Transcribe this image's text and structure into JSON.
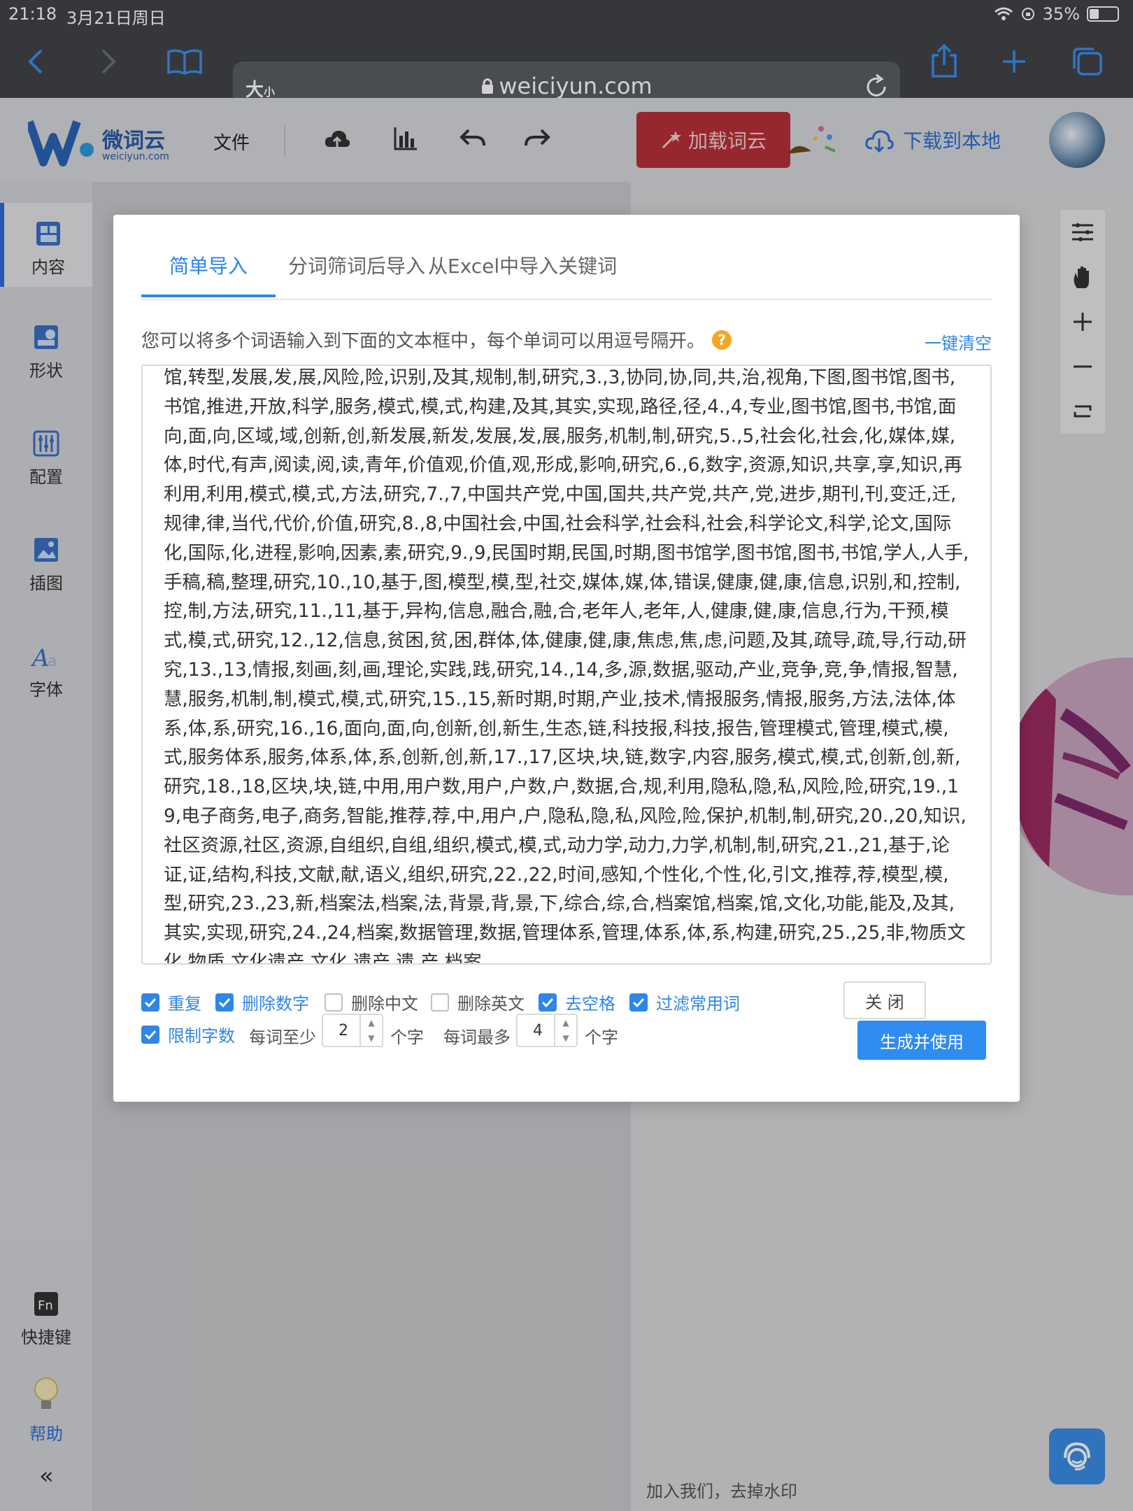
{
  "status": {
    "time": "21:18",
    "date": "3月21日周日",
    "battery": "35%",
    "battery_level": 0.35
  },
  "browser": {
    "aa": "大",
    "aa_small": "小",
    "domain": "weiciyun.com"
  },
  "app": {
    "brand": "微词云",
    "brand_sub": "weiciyun.com",
    "file_menu": "文件",
    "load_cloud": "加载词云",
    "download": "下载到本地"
  },
  "sidebar": {
    "items": [
      {
        "label": "内容"
      },
      {
        "label": "形状"
      },
      {
        "label": "配置"
      },
      {
        "label": "插图"
      },
      {
        "label": "字体"
      }
    ],
    "shortcut": "快捷键",
    "help": "帮助"
  },
  "canvas": {
    "watermark": "加入我们，去掉水印"
  },
  "modal": {
    "tabs": [
      {
        "label": "简单导入"
      },
      {
        "label": "分词筛词后导入"
      },
      {
        "label": "从Excel中导入关键词"
      }
    ],
    "hint": "您可以将多个词语输入到下面的文本框中，每个单词可以用逗号隔开。",
    "clear_all": "一键清空",
    "text": "馆,转型,发展,发,展,风险,险,识别,及其,规制,制,研究,3.,3,协同,协,同,共,治,视角,下图,图书馆,图书,书馆,推进,开放,科学,服务,模式,模,式,构建,及其,其实,实现,路径,径,4.,4,专业,图书馆,图书,书馆,面向,面,向,区域,域,创新,创,新发展,新发,发展,发,展,服务,机制,制,研究,5.,5,社会化,社会,化,媒体,媒,体,时代,有声,阅读,阅,读,青年,价值观,价值,观,形成,影响,研究,6.,6,数字,资源,知识,共享,享,知识,再利用,利用,模式,模,式,方法,研究,7.,7,中国共产党,中国,国共,共产党,共产,党,进步,期刊,刊,变迁,迁,规律,律,当代,代价,价值,研究,8.,8,中国社会,中国,社会科学,社会科,社会,科学论文,科学,论文,国际化,国际,化,进程,影响,因素,素,研究,9.,9,民国时期,民国,时期,图书馆学,图书馆,图书,书馆,学人,人手,手稿,稿,整理,研究,10.,10,基于,图,模型,模,型,社交,媒体,媒,体,错误,健康,健,康,信息,识别,和,控制,控,制,方法,研究,11.,11,基于,异构,信息,融合,融,合,老年人,老年,人,健康,健,康,信息,行为,干预,模式,模,式,研究,12.,12,信息,贫困,贫,困,群体,体,健康,健,康,焦虑,焦,虑,问题,及其,疏导,疏,导,行动,研究,13.,13,情报,刻画,刻,画,理论,实践,践,研究,14.,14,多,源,数据,驱动,产业,竞争,竞,争,情报,智慧,慧,服务,机制,制,模式,模,式,研究,15.,15,新时期,时期,产业,技术,情报服务,情报,服务,方法,法体,体系,体,系,研究,16.,16,面向,面,向,创新,创,新生,生态,链,科技报,科技,报告,管理模式,管理,模式,模,式,服务体系,服务,体系,体,系,创新,创,新,17.,17,区块,块,链,数字,内容,服务,模式,模,式,创新,创,新,研究,18.,18,区块,块,链,中用,用户数,用户,户数,户,数据,合,规,利用,隐私,隐,私,风险,险,研究,19.,19,电子商务,电子,商务,智能,推荐,荐,中,用户,户,隐私,隐,私,风险,险,保护,机制,制,研究,20.,20,知识,社区资源,社区,资源,自组织,自组,组织,模式,模,式,动力学,动力,力学,机制,制,研究,21.,21,基于,论证,证,结构,科技,文献,献,语义,组织,研究,22.,22,时间,感知,个性化,个性,化,引文,推荐,荐,模型,模,型,研究,23.,23,新,档案法,档案,法,背景,背,景,下,综合,综,合,档案馆,档案,馆,文化,功能,能及,及其,其实,实现,研究,24.,24,档案,数据管理,数据,管理体系,管理,体系,体,系,构建,研究,25.,25,非,物质文化,物质,文化遗产,文化,遗产,遗,产,档案",
    "options": {
      "repeat": {
        "label": "重复",
        "checked": true
      },
      "remove_numbers": {
        "label": "删除数字",
        "checked": true
      },
      "remove_chinese": {
        "label": "删除中文",
        "checked": false
      },
      "remove_english": {
        "label": "删除英文",
        "checked": false
      },
      "remove_spaces": {
        "label": "去空格",
        "checked": true
      },
      "filter_common": {
        "label": "过滤常用词",
        "checked": true
      },
      "limit_chars": {
        "label": "限制字数",
        "checked": true
      }
    },
    "min_label": "每词至少",
    "min_value": "2",
    "max_label": "每词最多",
    "max_value": "4",
    "unit": "个字",
    "close": "关 闭",
    "generate": "生成并使用"
  },
  "colors": {
    "accent": "#2f86e6",
    "load_button": "#b8303a",
    "generate_button": "#2f8cf0"
  }
}
